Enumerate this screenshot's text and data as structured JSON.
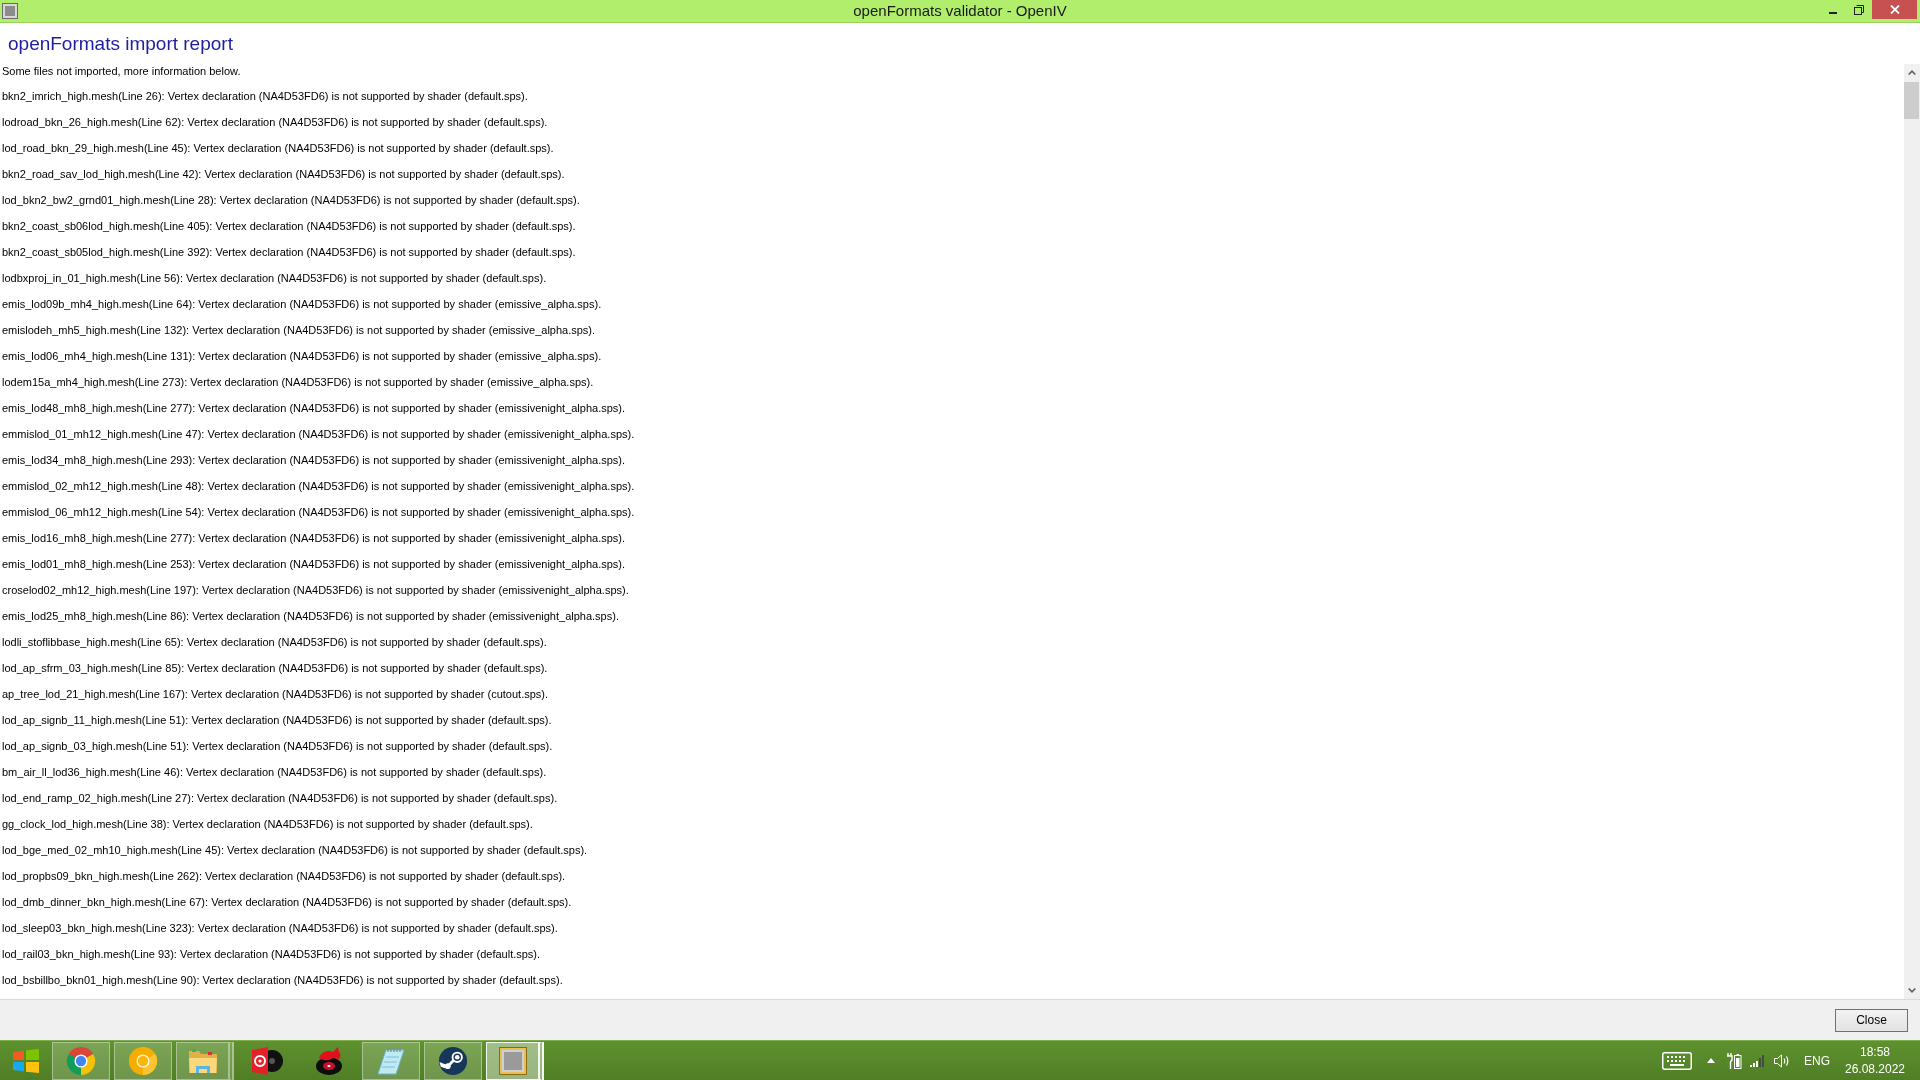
{
  "window": {
    "title": "openFormats validator - OpenIV"
  },
  "report": {
    "heading": "openFormats import report",
    "summary": "Some files not imported, more information below.",
    "messages": [
      "bkn2_imrich_high.mesh(Line 26): Vertex declaration (NA4D53FD6) is not supported by shader (default.sps).",
      "lodroad_bkn_26_high.mesh(Line 62): Vertex declaration (NA4D53FD6) is not supported by shader (default.sps).",
      "lod_road_bkn_29_high.mesh(Line 45): Vertex declaration (NA4D53FD6) is not supported by shader (default.sps).",
      "bkn2_road_sav_lod_high.mesh(Line 42): Vertex declaration (NA4D53FD6) is not supported by shader (default.sps).",
      "lod_bkn2_bw2_grnd01_high.mesh(Line 28): Vertex declaration (NA4D53FD6) is not supported by shader (default.sps).",
      "bkn2_coast_sb06lod_high.mesh(Line 405): Vertex declaration (NA4D53FD6) is not supported by shader (default.sps).",
      "bkn2_coast_sb05lod_high.mesh(Line 392): Vertex declaration (NA4D53FD6) is not supported by shader (default.sps).",
      "lodbxproj_in_01_high.mesh(Line 56): Vertex declaration (NA4D53FD6) is not supported by shader (default.sps).",
      "emis_lod09b_mh4_high.mesh(Line 64): Vertex declaration (NA4D53FD6) is not supported by shader (emissive_alpha.sps).",
      "emislodeh_mh5_high.mesh(Line 132): Vertex declaration (NA4D53FD6) is not supported by shader (emissive_alpha.sps).",
      "emis_lod06_mh4_high.mesh(Line 131): Vertex declaration (NA4D53FD6) is not supported by shader (emissive_alpha.sps).",
      "lodem15a_mh4_high.mesh(Line 273): Vertex declaration (NA4D53FD6) is not supported by shader (emissive_alpha.sps).",
      "emis_lod48_mh8_high.mesh(Line 277): Vertex declaration (NA4D53FD6) is not supported by shader (emissivenight_alpha.sps).",
      "emmislod_01_mh12_high.mesh(Line 47): Vertex declaration (NA4D53FD6) is not supported by shader (emissivenight_alpha.sps).",
      "emis_lod34_mh8_high.mesh(Line 293): Vertex declaration (NA4D53FD6) is not supported by shader (emissivenight_alpha.sps).",
      "emmislod_02_mh12_high.mesh(Line 48): Vertex declaration (NA4D53FD6) is not supported by shader (emissivenight_alpha.sps).",
      "emmislod_06_mh12_high.mesh(Line 54): Vertex declaration (NA4D53FD6) is not supported by shader (emissivenight_alpha.sps).",
      "emis_lod16_mh8_high.mesh(Line 277): Vertex declaration (NA4D53FD6) is not supported by shader (emissivenight_alpha.sps).",
      "emis_lod01_mh8_high.mesh(Line 253): Vertex declaration (NA4D53FD6) is not supported by shader (emissivenight_alpha.sps).",
      "croselod02_mh12_high.mesh(Line 197): Vertex declaration (NA4D53FD6) is not supported by shader (emissivenight_alpha.sps).",
      "emis_lod25_mh8_high.mesh(Line 86): Vertex declaration (NA4D53FD6) is not supported by shader (emissivenight_alpha.sps).",
      "lodli_stoflibbase_high.mesh(Line 65): Vertex declaration (NA4D53FD6) is not supported by shader (default.sps).",
      "lod_ap_sfrm_03_high.mesh(Line 85): Vertex declaration (NA4D53FD6) is not supported by shader (default.sps).",
      "ap_tree_lod_21_high.mesh(Line 167): Vertex declaration (NA4D53FD6) is not supported by shader (cutout.sps).",
      "lod_ap_signb_11_high.mesh(Line 51): Vertex declaration (NA4D53FD6) is not supported by shader (default.sps).",
      "lod_ap_signb_03_high.mesh(Line 51): Vertex declaration (NA4D53FD6) is not supported by shader (default.sps).",
      "bm_air_ll_lod36_high.mesh(Line 46): Vertex declaration (NA4D53FD6) is not supported by shader (default.sps).",
      "lod_end_ramp_02_high.mesh(Line 27): Vertex declaration (NA4D53FD6) is not supported by shader (default.sps).",
      "gg_clock_lod_high.mesh(Line 38): Vertex declaration (NA4D53FD6) is not supported by shader (default.sps).",
      "lod_bge_med_02_mh10_high.mesh(Line 45): Vertex declaration (NA4D53FD6) is not supported by shader (default.sps).",
      "lod_propbs09_bkn_high.mesh(Line 262): Vertex declaration (NA4D53FD6) is not supported by shader (default.sps).",
      "lod_dmb_dinner_bkn_high.mesh(Line 67): Vertex declaration (NA4D53FD6) is not supported by shader (default.sps).",
      "lod_sleep03_bkn_high.mesh(Line 323): Vertex declaration (NA4D53FD6) is not supported by shader (default.sps).",
      "lod_rail03_bkn_high.mesh(Line 93): Vertex declaration (NA4D53FD6) is not supported by shader (default.sps).",
      "lod_bsbillbo_bkn01_high.mesh(Line 90): Vertex declaration (NA4D53FD6) is not supported by shader (default.sps)."
    ]
  },
  "dialog_buttons": [
    {
      "label": "Close",
      "focused": true
    }
  ],
  "taskbar": {
    "apps": [
      {
        "running": true,
        "stacked": false,
        "selected": false
      },
      {
        "running": true,
        "stacked": false,
        "selected": false
      },
      {
        "running": true,
        "stacked": true,
        "selected": false
      },
      {
        "running": false,
        "stacked": false,
        "selected": false
      },
      {
        "running": false,
        "stacked": false,
        "selected": false
      },
      {
        "running": true,
        "stacked": false,
        "selected": false
      },
      {
        "running": true,
        "stacked": false,
        "selected": false
      },
      {
        "running": true,
        "stacked": true,
        "selected": true
      }
    ],
    "tray": {
      "input_language": "ENG",
      "time": "18:58",
      "date": "26.08.2022"
    }
  }
}
